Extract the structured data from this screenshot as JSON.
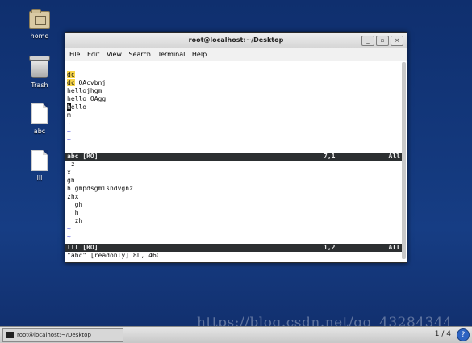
{
  "desktop": {
    "icons": [
      {
        "label": "home",
        "type": "folder"
      },
      {
        "label": "Trash",
        "type": "trash"
      },
      {
        "label": "abc",
        "type": "file"
      },
      {
        "label": "lll",
        "type": "file"
      }
    ]
  },
  "window": {
    "title": "root@localhost:~/Desktop",
    "buttons": {
      "minimize": "_",
      "maximize": "▫",
      "close": "×"
    },
    "menu": [
      "File",
      "Edit",
      "View",
      "Search",
      "Terminal",
      "Help"
    ]
  },
  "vim": {
    "top_lines": [
      "",
      "dc",
      "dc OAcvbnj",
      "hellojhgm",
      "hello OAgg",
      "hello",
      "m",
      "~",
      "~",
      "~"
    ],
    "top_status": {
      "name": "abc [RO]",
      "pos": "7,1",
      "pct": "All"
    },
    "bottom_lines": [
      " z",
      "x",
      "gh",
      "h gmpdsgmisndvgnz",
      "zhx",
      "  gh",
      "  h",
      "  zh",
      "~",
      "~"
    ],
    "bottom_status": {
      "name": "lll [RO]",
      "pos": "1,2",
      "pct": "All"
    },
    "command_line": "\"abc\" [readonly] 8L, 46C"
  },
  "taskbar": {
    "item_label": "root@localhost:~/Desktop",
    "workspace": "1 / 4",
    "help": "?"
  },
  "watermark": "https://blog.csdn.net/qq_43284344",
  "colors": {
    "desktop_bg": "#12306f",
    "highlight": "#f7d54a",
    "status_bar": "#2c2f31",
    "tilde": "#5555dd"
  }
}
